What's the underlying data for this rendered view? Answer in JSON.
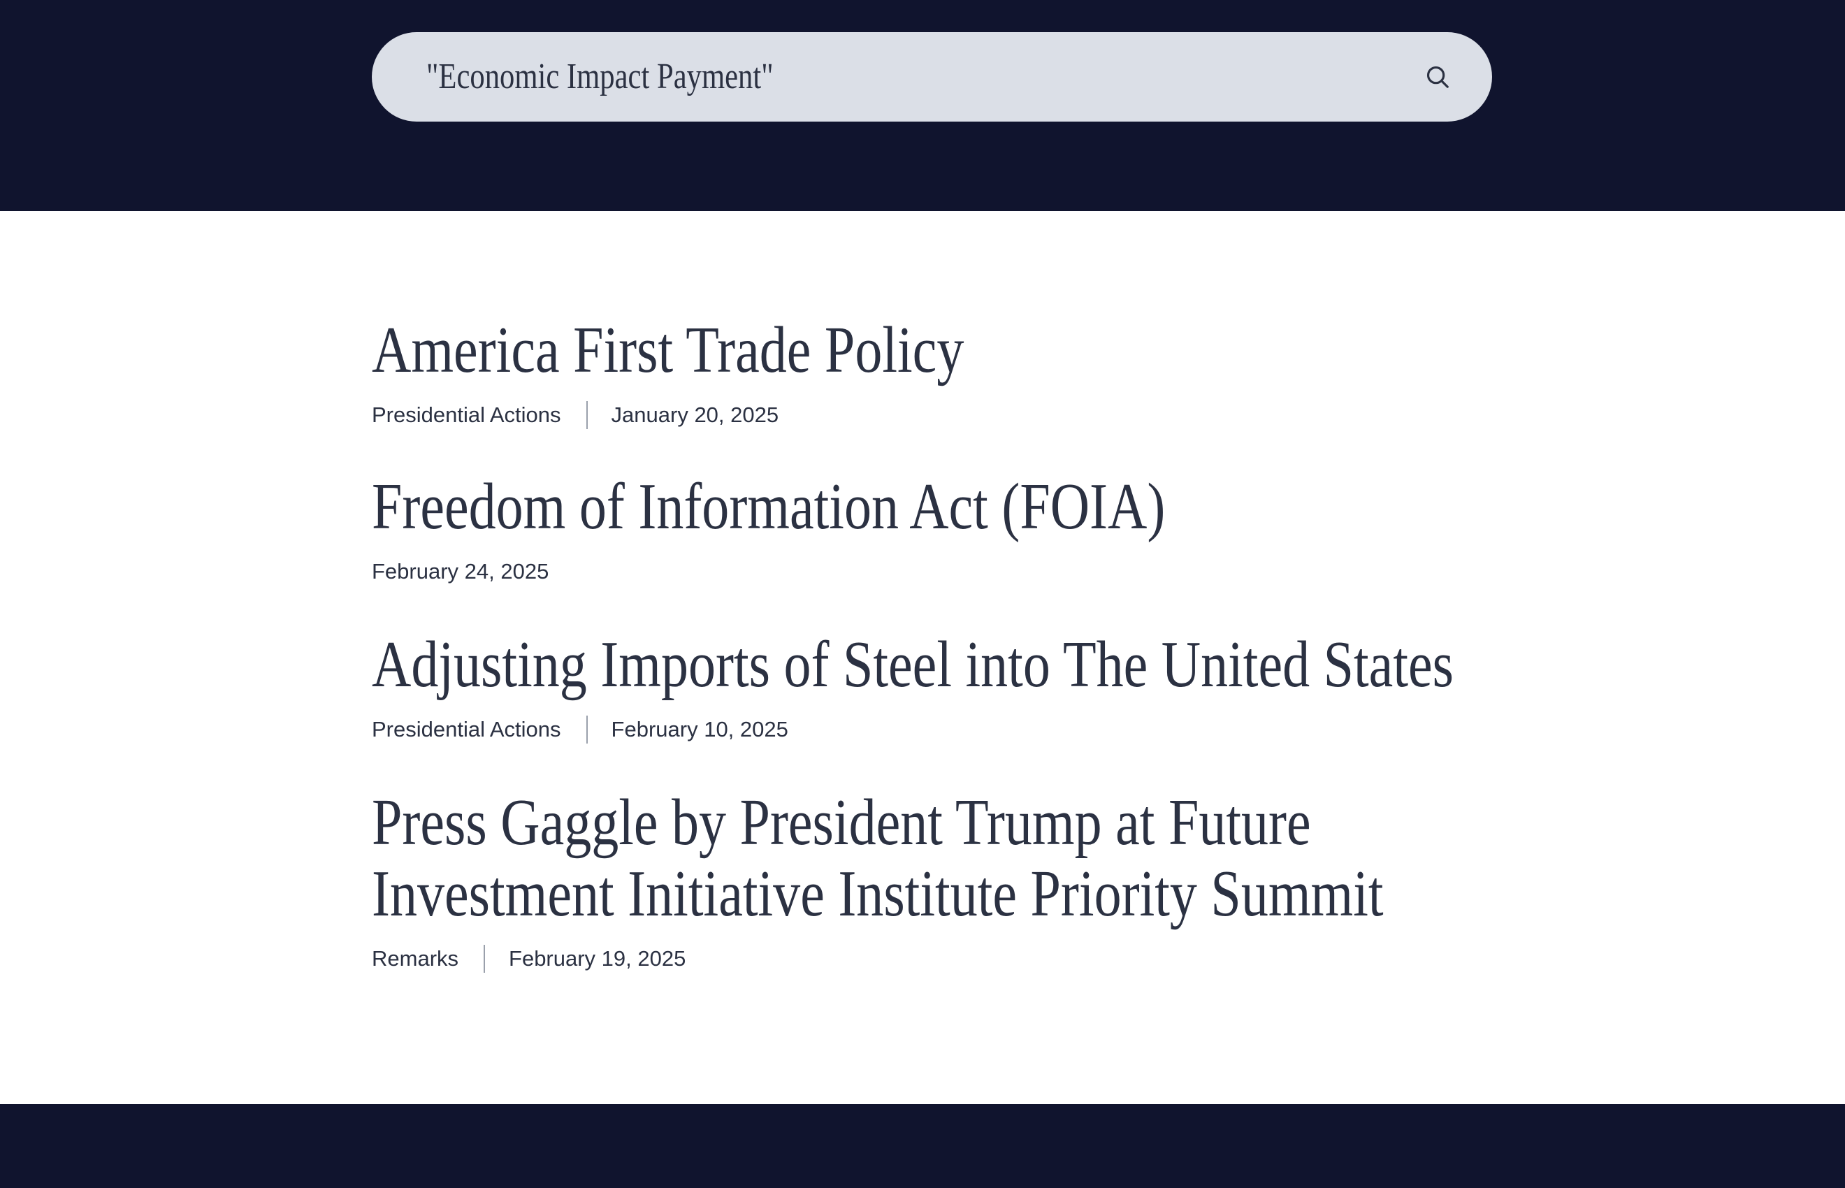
{
  "search": {
    "query": "\"Economic Impact Payment\"",
    "button_icon": "search-icon"
  },
  "results": [
    {
      "title_lines": [
        "America First Trade Policy"
      ],
      "category": "Presidential Actions",
      "date": "January 20, 2025"
    },
    {
      "title_lines": [
        "Freedom of Information Act (FOIA)"
      ],
      "category": "",
      "date": "February 24, 2025"
    },
    {
      "title_lines": [
        "Adjusting Imports of Steel into The United States"
      ],
      "category": "Presidential Actions",
      "date": "February 10, 2025"
    },
    {
      "title_lines": [
        "Press Gaggle by President Trump at Future",
        "Investment Initiative Institute Priority Summit"
      ],
      "category": "Remarks",
      "date": "February 19, 2025"
    }
  ],
  "colors": {
    "header_bg": "#10142e",
    "search_bg": "#dbdfe7",
    "text": "#2b3142",
    "divider": "#9aa0ab"
  }
}
